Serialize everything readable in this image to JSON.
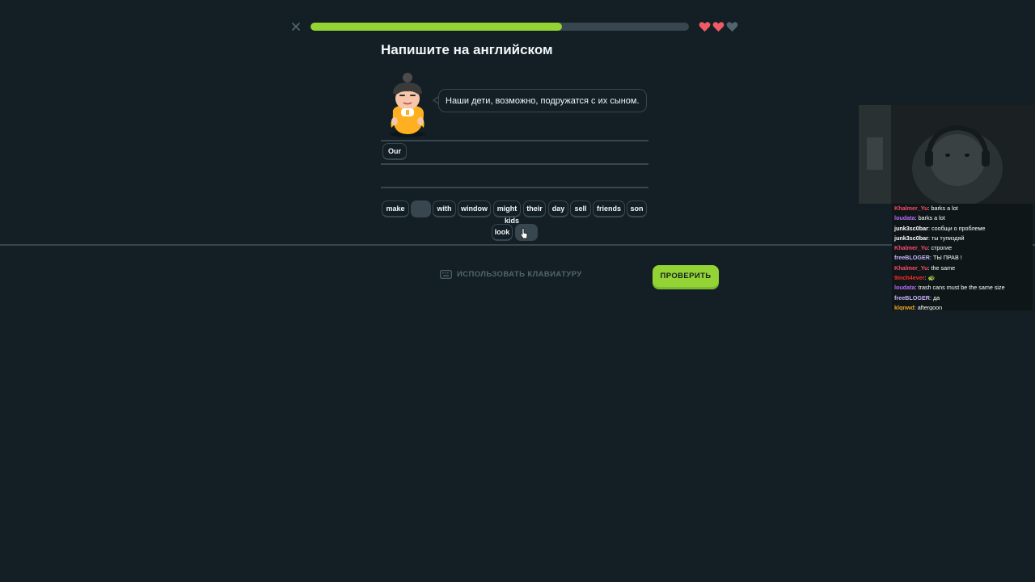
{
  "progress": {
    "fraction": 0.665
  },
  "hearts": [
    {
      "state": "full",
      "color": "#ee5b66"
    },
    {
      "state": "full",
      "color": "#ee5b66"
    },
    {
      "state": "empty",
      "color": "#52656d"
    }
  ],
  "title": "Напишите на английском",
  "prompt": "Наши дети, возможно, подружатся с их сыном.",
  "answer_tiles": [
    "Our"
  ],
  "word_bank": [
    "make",
    "",
    "with",
    "window",
    "might",
    "their",
    "day",
    "sell",
    "friends",
    "son"
  ],
  "word_bank_row2": [
    "look",
    ""
  ],
  "dragging_word": "kids",
  "footer": {
    "keyboard_label": "ИСПОЛЬЗОВАТЬ КЛАВИАТУРУ",
    "check_label": "ПРОВЕРИТЬ"
  },
  "colors": {
    "background": "#131f24",
    "accent_green": "#93d333",
    "border": "#37464f",
    "muted": "#52656d"
  },
  "chat": [
    {
      "user": "Khalmer_Yu",
      "message": "barks a lot",
      "color": "#ff4a6b"
    },
    {
      "user": "loudata",
      "message": "barks a lot",
      "color": "#b86bff"
    },
    {
      "user": "junk3sc0bar",
      "message": "сообщи о проблеме",
      "color": "#ffffff"
    },
    {
      "user": "junk3sc0bar",
      "message": "ты тупиздяй",
      "color": "#ffffff"
    },
    {
      "user": "Khalmer_Yu",
      "message": "строгие",
      "color": "#ff4a6b"
    },
    {
      "user": "freeBLOGER",
      "message": "ТЫ ПРАВ !",
      "color": "#c9b3ff"
    },
    {
      "user": "Khalmer_Yu",
      "message": "the same",
      "color": "#ff4a6b"
    },
    {
      "user": "9inch4ever",
      "message": "🐢",
      "color": "#ff2a2a"
    },
    {
      "user": "loudata",
      "message": "trash cans must be the same size",
      "color": "#b86bff"
    },
    {
      "user": "freeBLOGER",
      "message": "да",
      "color": "#c9b3ff"
    },
    {
      "user": "klqnwd",
      "message": "aftergoon",
      "color": "#f5a623"
    }
  ]
}
